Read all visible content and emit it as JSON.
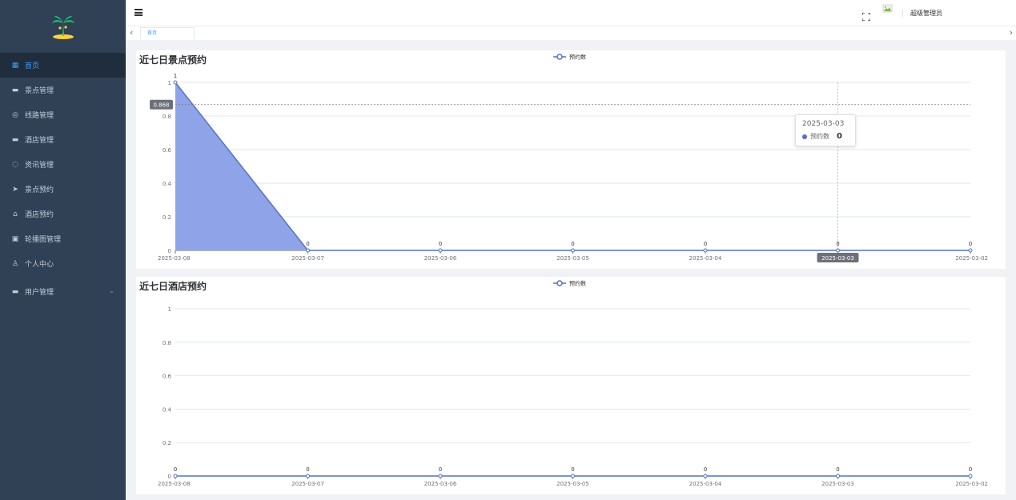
{
  "header": {
    "user_name": "超级管理员",
    "tab_label": "首页"
  },
  "sidebar": {
    "items": [
      {
        "label": "首页",
        "icon": "dashboard-icon",
        "active": true
      },
      {
        "label": "景点管理",
        "icon": "ticket-icon"
      },
      {
        "label": "线路管理",
        "icon": "route-icon"
      },
      {
        "label": "酒店管理",
        "icon": "hotel-icon"
      },
      {
        "label": "资讯管理",
        "icon": "news-icon"
      },
      {
        "label": "景点预约",
        "icon": "send-icon"
      },
      {
        "label": "酒店预约",
        "icon": "home-icon"
      },
      {
        "label": "轮播图管理",
        "icon": "picture-icon"
      },
      {
        "label": "个人中心",
        "icon": "user-icon"
      },
      {
        "label": "用户管理",
        "icon": "users-icon"
      }
    ]
  },
  "colors": {
    "sidebar_bg": "#304156",
    "accent": "#409eff",
    "series": "#5470c6",
    "area": "#8fa3e8"
  },
  "tooltip": {
    "date": "2025-03-03",
    "series_name": "预约数",
    "value": "0"
  },
  "axis_pointer": {
    "y_label": "0.868",
    "x_label": "2025-03-03"
  },
  "chart_data": [
    {
      "type": "area",
      "title": "近七日景点预约",
      "categories": [
        "2025-03-08",
        "2025-03-07",
        "2025-03-06",
        "2025-03-05",
        "2025-03-04",
        "2025-03-03",
        "2025-03-02"
      ],
      "series": [
        {
          "name": "预约数",
          "values": [
            1,
            0,
            0,
            0,
            0,
            0,
            0
          ]
        }
      ],
      "ylim": [
        0,
        1
      ],
      "yticks": [
        "0",
        "0.2",
        "0.4",
        "0.6",
        "0.8",
        "1"
      ],
      "legend": "top-center",
      "grid": true
    },
    {
      "type": "line",
      "title": "近七日酒店预约",
      "categories": [
        "2025-03-08",
        "2025-03-07",
        "2025-03-06",
        "2025-03-05",
        "2025-03-04",
        "2025-03-03",
        "2025-03-02"
      ],
      "series": [
        {
          "name": "预约数",
          "values": [
            0,
            0,
            0,
            0,
            0,
            0,
            0
          ]
        }
      ],
      "ylim": [
        0,
        1
      ],
      "yticks": [
        "0",
        "0.2",
        "0.4",
        "0.6",
        "0.8",
        "1"
      ],
      "legend": "top-center",
      "grid": true
    }
  ]
}
